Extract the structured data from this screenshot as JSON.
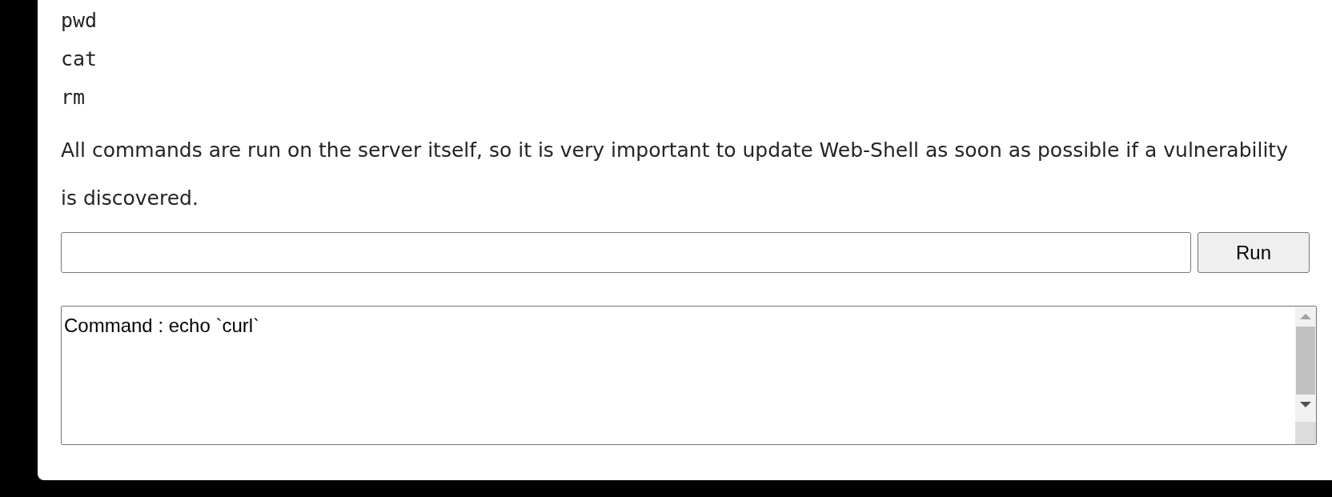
{
  "commands": [
    "pwd",
    "cat",
    "rm"
  ],
  "notice": "All commands are run on the server itself, so it is very important to update Web-Shell as soon as possible if a vulnerability is discovered.",
  "run_button": {
    "label": "Run"
  },
  "output": {
    "text": "Command : echo `curl`"
  }
}
